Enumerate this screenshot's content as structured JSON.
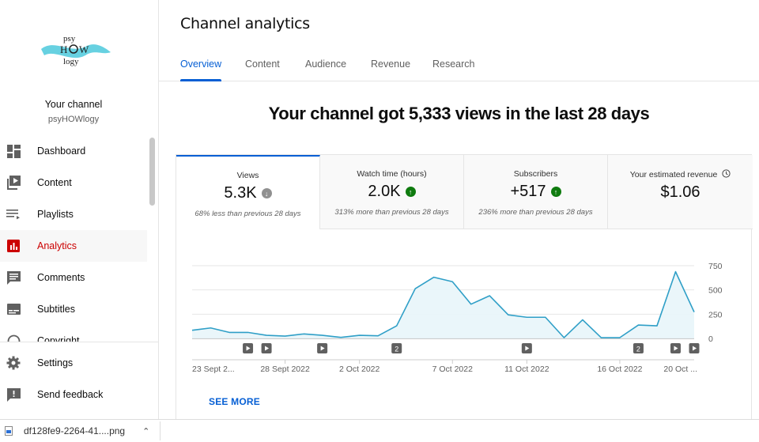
{
  "sidebar": {
    "logo_text": "psyHOWlogy",
    "channel_title": "Your channel",
    "channel_name": "psyHOWlogy",
    "items": [
      {
        "label": "Dashboard",
        "icon": "dashboard-icon"
      },
      {
        "label": "Content",
        "icon": "content-icon"
      },
      {
        "label": "Playlists",
        "icon": "playlists-icon"
      },
      {
        "label": "Analytics",
        "icon": "analytics-icon",
        "active": true
      },
      {
        "label": "Comments",
        "icon": "comments-icon"
      },
      {
        "label": "Subtitles",
        "icon": "subtitles-icon"
      },
      {
        "label": "Copyright",
        "icon": "copyright-icon"
      }
    ],
    "bottom_items": [
      {
        "label": "Settings",
        "icon": "gear-icon"
      },
      {
        "label": "Send feedback",
        "icon": "feedback-icon"
      }
    ]
  },
  "header": {
    "title": "Channel analytics",
    "tabs": [
      {
        "label": "Overview",
        "active": true
      },
      {
        "label": "Content"
      },
      {
        "label": "Audience"
      },
      {
        "label": "Revenue"
      },
      {
        "label": "Research"
      }
    ]
  },
  "headline": "Your channel got 5,333 views in the last 28 days",
  "metrics": [
    {
      "title": "Views",
      "value": "5.3K",
      "trend": "down",
      "comparison": "68% less than previous 28 days"
    },
    {
      "title": "Watch time (hours)",
      "value": "2.0K",
      "trend": "up",
      "comparison": "313% more than previous 28 days"
    },
    {
      "title": "Subscribers",
      "value": "+517",
      "trend": "up",
      "comparison": "236% more than previous 28 days"
    },
    {
      "title": "Your estimated revenue",
      "value": "$1.06",
      "icon": "clock-icon"
    }
  ],
  "see_more": "SEE MORE",
  "download_bar": {
    "filename": "df128fe9-2264-41....png"
  },
  "colors": {
    "accent": "#065fd4",
    "active_nav": "#cc0000",
    "line": "#2f9fc7",
    "fill": "#e8f5fa",
    "up": "#0f7b0f",
    "down": "#909090"
  },
  "chart_data": {
    "type": "area",
    "x": [
      "23 Sept",
      "24 Sept",
      "25 Sept",
      "26 Sept",
      "27 Sept",
      "28 Sept",
      "29 Sept",
      "30 Sept",
      "1 Oct",
      "2 Oct",
      "3 Oct",
      "4 Oct",
      "5 Oct",
      "6 Oct",
      "7 Oct",
      "8 Oct",
      "9 Oct",
      "10 Oct",
      "11 Oct",
      "12 Oct",
      "13 Oct",
      "14 Oct",
      "15 Oct",
      "16 Oct",
      "17 Oct",
      "18 Oct",
      "19 Oct",
      "20 Oct"
    ],
    "values": [
      84,
      108,
      62,
      62,
      32,
      24,
      46,
      32,
      11,
      32,
      27,
      130,
      513,
      631,
      585,
      353,
      440,
      243,
      218,
      218,
      8,
      192,
      8,
      8,
      138,
      130,
      688,
      272
    ],
    "ylim": [
      0,
      750
    ],
    "yticks": [
      "0",
      "250",
      "500",
      "750"
    ],
    "xtick_labels": [
      {
        "index": 0,
        "label": "23 Sept 2..."
      },
      {
        "index": 5,
        "label": "28 Sept 2022"
      },
      {
        "index": 9,
        "label": "2 Oct 2022"
      },
      {
        "index": 14,
        "label": "7 Oct 2022"
      },
      {
        "index": 18,
        "label": "11 Oct 2022"
      },
      {
        "index": 23,
        "label": "16 Oct 2022"
      },
      {
        "index": 27,
        "label": "20 Oct ..."
      }
    ],
    "markers": [
      {
        "index": 3,
        "kind": "video"
      },
      {
        "index": 4,
        "kind": "video"
      },
      {
        "index": 7,
        "kind": "video"
      },
      {
        "index": 11,
        "kind": "count",
        "label": "2"
      },
      {
        "index": 18,
        "kind": "video"
      },
      {
        "index": 24,
        "kind": "count",
        "label": "2"
      },
      {
        "index": 26,
        "kind": "video"
      },
      {
        "index": 27,
        "kind": "video"
      }
    ],
    "grid": true
  }
}
